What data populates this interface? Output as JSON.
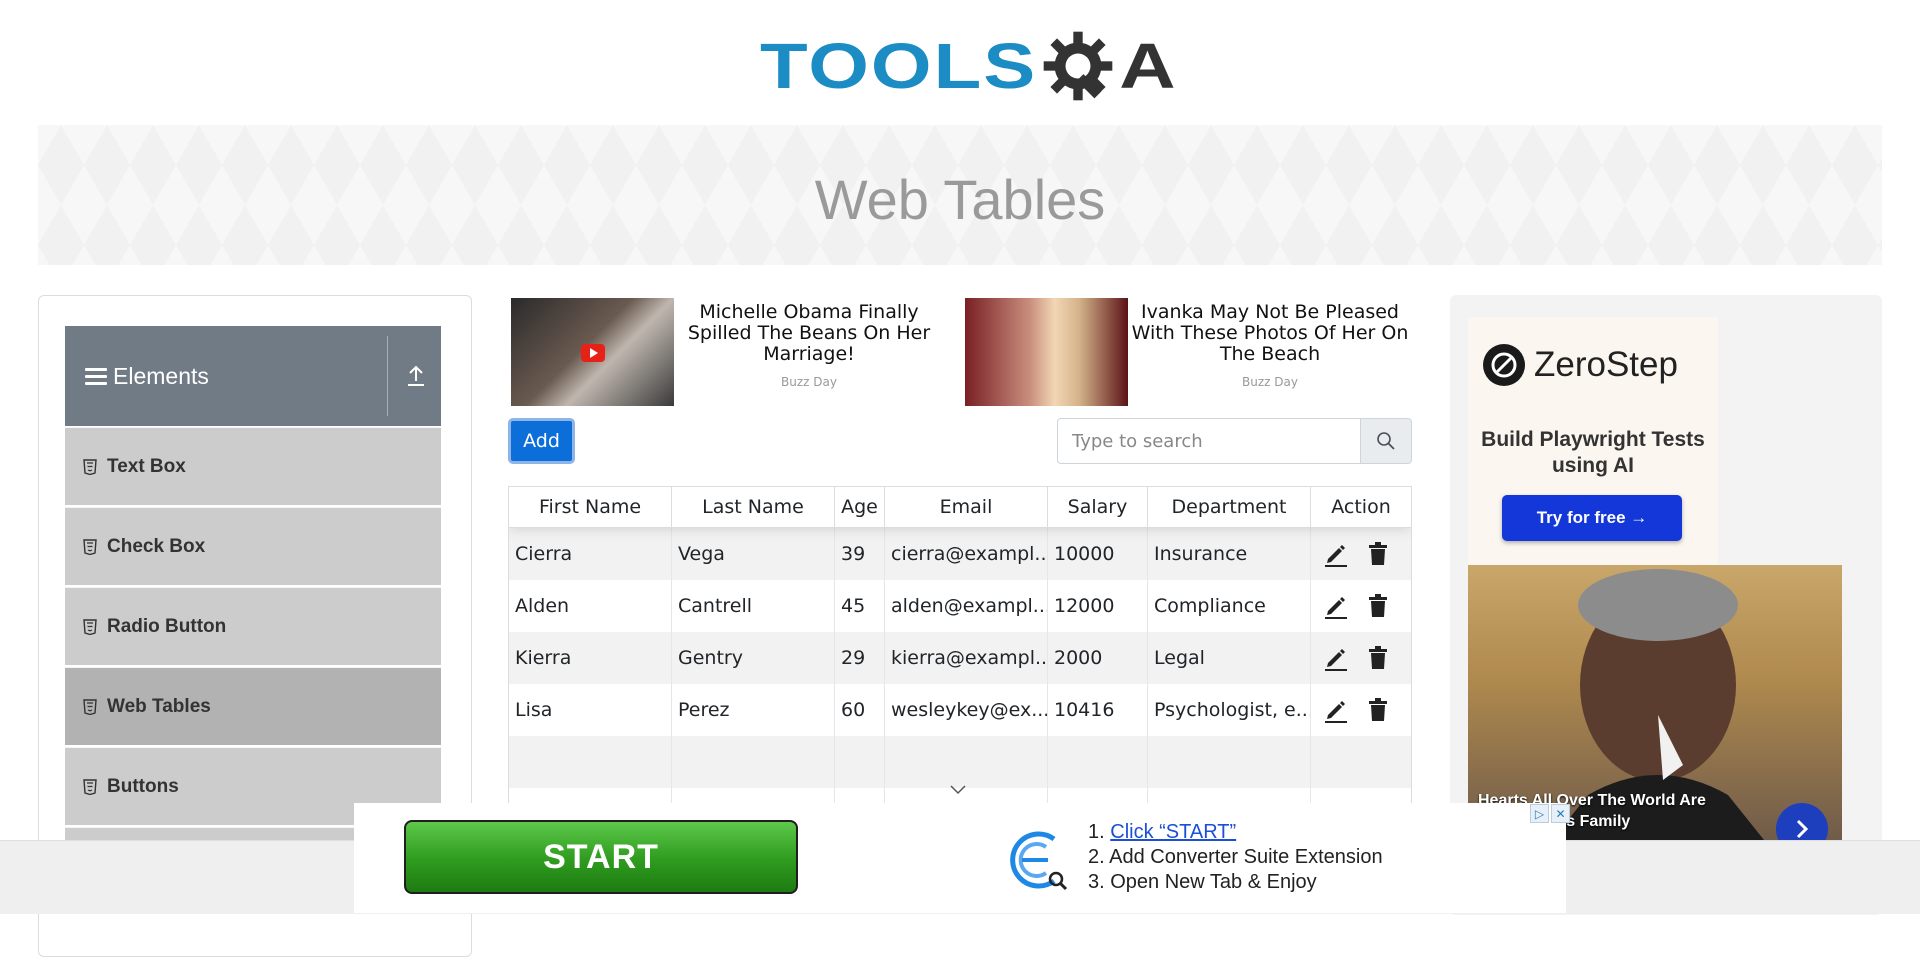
{
  "header": {
    "logo_text": "TOOLS",
    "logo_qa": "A"
  },
  "banner": {
    "title": "Web Tables"
  },
  "sidebar": {
    "group_title": "Elements",
    "items": [
      {
        "label": "Text Box"
      },
      {
        "label": "Check Box"
      },
      {
        "label": "Radio Button"
      },
      {
        "label": "Web Tables",
        "active": true
      },
      {
        "label": "Buttons"
      }
    ]
  },
  "ads_top": [
    {
      "headline": "Michelle Obama Finally Spilled The Beans On Her Marriage!",
      "source": "Buzz Day"
    },
    {
      "headline": "Ivanka May Not Be Pleased With These Photos Of Her On The Beach",
      "source": "Buzz Day"
    }
  ],
  "controls": {
    "add_label": "Add",
    "search_placeholder": "Type to search"
  },
  "table": {
    "columns": [
      "First Name",
      "Last Name",
      "Age",
      "Email",
      "Salary",
      "Department",
      "Action"
    ],
    "rows": [
      [
        "Cierra",
        "Vega",
        "39",
        "cierra@exampl...",
        "10000",
        "Insurance"
      ],
      [
        "Alden",
        "Cantrell",
        "45",
        "alden@exampl...",
        "12000",
        "Compliance"
      ],
      [
        "Kierra",
        "Gentry",
        "29",
        "kierra@exampl...",
        "2000",
        "Legal"
      ],
      [
        "Lisa",
        "Perez",
        "60",
        "wesleykey@ex...",
        "10416",
        "Psychologist, e..."
      ]
    ]
  },
  "right_ad": {
    "brand": "ZeroStep",
    "tagline": "Build Playwright Tests using AI",
    "cta": "Try for free →",
    "caption_line1": "Hearts All Over The World Are",
    "caption_line2": "For Obama's Family"
  },
  "bottom_ad": {
    "start_label": "START",
    "step1_num": "1.",
    "step1": "Click “START”",
    "step2": "2. Add Converter Suite Extension",
    "step3": "3. Open New Tab & Enjoy"
  },
  "colors": {
    "logo_blue": "#1b8dc4",
    "add_button": "#0b6ed9",
    "sidebar_header": "#707b86",
    "zerostep_button": "#1337d8"
  }
}
